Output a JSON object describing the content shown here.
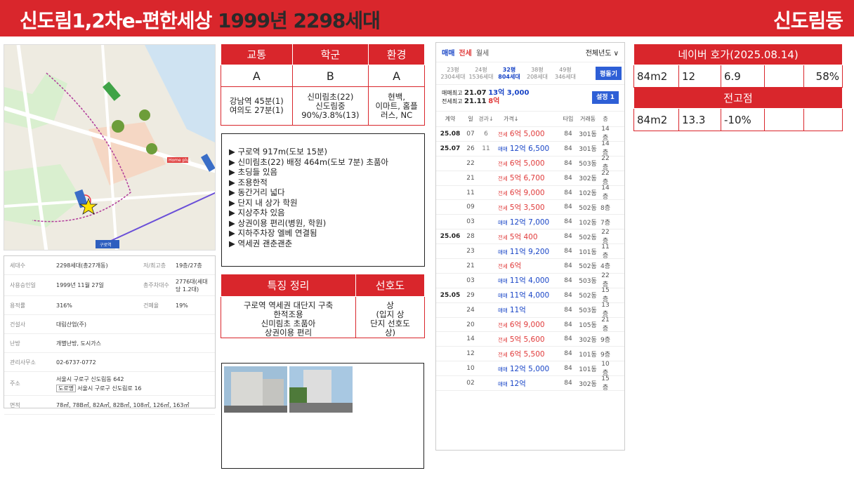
{
  "header": {
    "title": "신도림1,2차e-편한세상",
    "sub": " 1999년 2298세대",
    "region": "신도림동"
  },
  "map": {
    "labels": [
      "Home plus",
      "구로역",
      "신도림초",
      "신미림초",
      "신도림중"
    ],
    "bus": "구로역"
  },
  "info": {
    "rows": [
      {
        "k": "세대수",
        "v": "2298세대(총27개동)",
        "k2": "저/최고층",
        "v2": "19층/27층"
      },
      {
        "k": "사용승인일",
        "v": "1999년 11월 27일",
        "k2": "총주차대수",
        "v2": "2776대(세대당 1.2대)"
      },
      {
        "k": "용적률",
        "v": "316%",
        "k2": "건폐율",
        "v2": "19%"
      },
      {
        "k": "건설사",
        "v": "대림산업(주)"
      },
      {
        "k": "난방",
        "v": "개별난방, 도시가스"
      },
      {
        "k": "관리사무소",
        "v": "02-6737-0772"
      },
      {
        "k": "주소",
        "v": "서울시 구로구 신도림동 642",
        "v_road": "서울시 구로구 신도림로 16",
        "road_tag": "도로명"
      },
      {
        "k": "면적",
        "v": "78㎡, 78B㎡, 82A㎡, 82B㎡, 108㎡, 126㎡, 163㎡"
      }
    ]
  },
  "grades": {
    "headers": [
      "교통",
      "학군",
      "환경"
    ],
    "grades": [
      "A",
      "B",
      "A"
    ],
    "details": [
      [
        "강남역 45분(1)",
        "여의도 27분(1)"
      ],
      [
        "신미림초(22)",
        "신도림중",
        "90%/3.8%(13)"
      ],
      [
        "현백,",
        "이마트, 홈플",
        "러스, NC"
      ]
    ]
  },
  "bullets": [
    "▶ 구로역 917m(도보 15분)",
    "▶ 신미림초(22) 배정 464m(도보 7분) 초품아",
    "▶ 초딩들 있음",
    "▶ 조용한적",
    "▶ 동간거리 넓다",
    "▶ 단지 내 상가 학원",
    "▶ 지상주차 있음",
    "▶ 상권이용 편리(병원, 학원)",
    "▶ 지하주차장 엘베 연결됨",
    "▶ 역세권 괜춘괜춘"
  ],
  "features": {
    "h1": "특징 정리",
    "h2": "선호도",
    "left": [
      "구로역 역세권 대단지 구축",
      "한적조용",
      "신미림초 초품아",
      "상권이용 편리"
    ],
    "right": [
      "상",
      "(입지 상",
      "단지 선호도",
      "상)"
    ]
  },
  "panel": {
    "tabs": [
      "매매",
      "전세",
      "월세"
    ],
    "filter": "전체년도 ∨",
    "sizes": [
      {
        "p": "23평",
        "h": "2304세대"
      },
      {
        "p": "24평",
        "h": "1536세대"
      },
      {
        "p": "32평",
        "h": "804세대"
      },
      {
        "p": "38평",
        "h": "208세대"
      },
      {
        "p": "49평",
        "h": "346세대"
      }
    ],
    "size_btn": "평돌기",
    "max1_label": "매매최고",
    "max1_date": "21.07",
    "max1_val": "13억 3,000",
    "max2_label": "전세최고",
    "max2_date": "21.11",
    "max2_val": "8억",
    "set_btn": "설정 1",
    "cols": [
      "계약",
      "일",
      "경과↓",
      "가격↓",
      "타입",
      "거래동",
      "층"
    ],
    "rows": [
      {
        "m": "25.08",
        "d": "07",
        "e": "6",
        "t": "전세",
        "p": "6억 5,000",
        "ty": "84",
        "dong": "301동",
        "fl": "14층"
      },
      {
        "m": "25.07",
        "d": "26",
        "e": "11",
        "t": "매매",
        "p": "12억 6,500",
        "ty": "84",
        "dong": "301동",
        "fl": "14층"
      },
      {
        "m": "",
        "d": "22",
        "e": "",
        "t": "전세",
        "p": "6억 5,000",
        "ty": "84",
        "dong": "503동",
        "fl": "22층"
      },
      {
        "m": "",
        "d": "21",
        "e": "",
        "t": "전세",
        "p": "5억 6,700",
        "ty": "84",
        "dong": "302동",
        "fl": "22층"
      },
      {
        "m": "",
        "d": "11",
        "e": "",
        "t": "전세",
        "p": "6억 9,000",
        "ty": "84",
        "dong": "102동",
        "fl": "14층"
      },
      {
        "m": "",
        "d": "09",
        "e": "",
        "t": "전세",
        "p": "5억 3,500",
        "ty": "84",
        "dong": "502동",
        "fl": "8층"
      },
      {
        "m": "",
        "d": "03",
        "e": "",
        "t": "매매",
        "p": "12억 7,000",
        "ty": "84",
        "dong": "102동",
        "fl": "7층"
      },
      {
        "m": "25.06",
        "d": "28",
        "e": "",
        "t": "전세",
        "p": "5억 400",
        "ty": "84",
        "dong": "502동",
        "fl": "22층"
      },
      {
        "m": "",
        "d": "23",
        "e": "",
        "t": "매매",
        "p": "11억 9,200",
        "ty": "84",
        "dong": "101동",
        "fl": "11층"
      },
      {
        "m": "",
        "d": "21",
        "e": "",
        "t": "전세",
        "p": "6억",
        "ty": "84",
        "dong": "502동",
        "fl": "4층"
      },
      {
        "m": "",
        "d": "03",
        "e": "",
        "t": "매매",
        "p": "11억 4,000",
        "ty": "84",
        "dong": "503동",
        "fl": "22층"
      },
      {
        "m": "25.05",
        "d": "29",
        "e": "",
        "t": "매매",
        "p": "11억 4,000",
        "ty": "84",
        "dong": "502동",
        "fl": "15층"
      },
      {
        "m": "",
        "d": "24",
        "e": "",
        "t": "매매",
        "p": "11억",
        "ty": "84",
        "dong": "503동",
        "fl": "13층"
      },
      {
        "m": "",
        "d": "20",
        "e": "",
        "t": "전세",
        "p": "6억 9,000",
        "ty": "84",
        "dong": "105동",
        "fl": "21층"
      },
      {
        "m": "",
        "d": "14",
        "e": "",
        "t": "전세",
        "p": "5억 5,600",
        "ty": "84",
        "dong": "302동",
        "fl": "9층"
      },
      {
        "m": "",
        "d": "12",
        "e": "",
        "t": "전세",
        "p": "6억 5,500",
        "ty": "84",
        "dong": "101동",
        "fl": "9층"
      },
      {
        "m": "",
        "d": "10",
        "e": "",
        "t": "매매",
        "p": "12억 5,000",
        "ty": "84",
        "dong": "101동",
        "fl": "10층"
      },
      {
        "m": "",
        "d": "02",
        "e": "",
        "t": "매매",
        "p": "12억",
        "ty": "84",
        "dong": "302동",
        "fl": "15층"
      }
    ]
  },
  "naver": {
    "h1": "네이버 호가(2025.08.14)",
    "r1": [
      "84m2",
      "12",
      "6.9",
      "",
      "58%"
    ],
    "h2": "전고점",
    "r2": [
      "84m2",
      "13.3",
      "-10%",
      "",
      ""
    ]
  }
}
